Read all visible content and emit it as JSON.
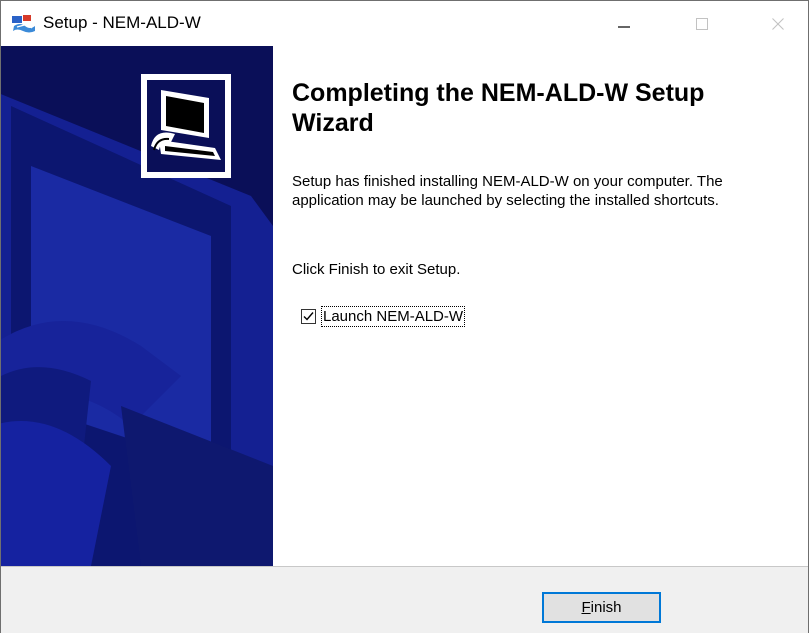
{
  "window": {
    "title": "Setup - NEM-ALD-W",
    "app_icon": "setup-app-icon"
  },
  "title_buttons": {
    "minimize_icon": "minimize-icon",
    "maximize_icon": "maximize-icon",
    "close_icon": "close-icon"
  },
  "side_panel": {
    "image": "wizard-banner-image",
    "icon": "installer-computer-icon",
    "background_color": "#0a0f58"
  },
  "content": {
    "heading": "Completing the NEM-ALD-W Setup Wizard",
    "description": "Setup has finished installing NEM-ALD-W on your computer. The application may be launched by selecting the installed shortcuts.",
    "exit_instruction": "Click Finish to exit Setup."
  },
  "launch_option": {
    "label": "Launch NEM-ALD-W",
    "checked": true
  },
  "footer": {
    "finish_button": {
      "mnemonic": "F",
      "rest": "inish"
    }
  },
  "colors": {
    "accent": "#0078d7",
    "footer_background": "#f0f0f0"
  }
}
